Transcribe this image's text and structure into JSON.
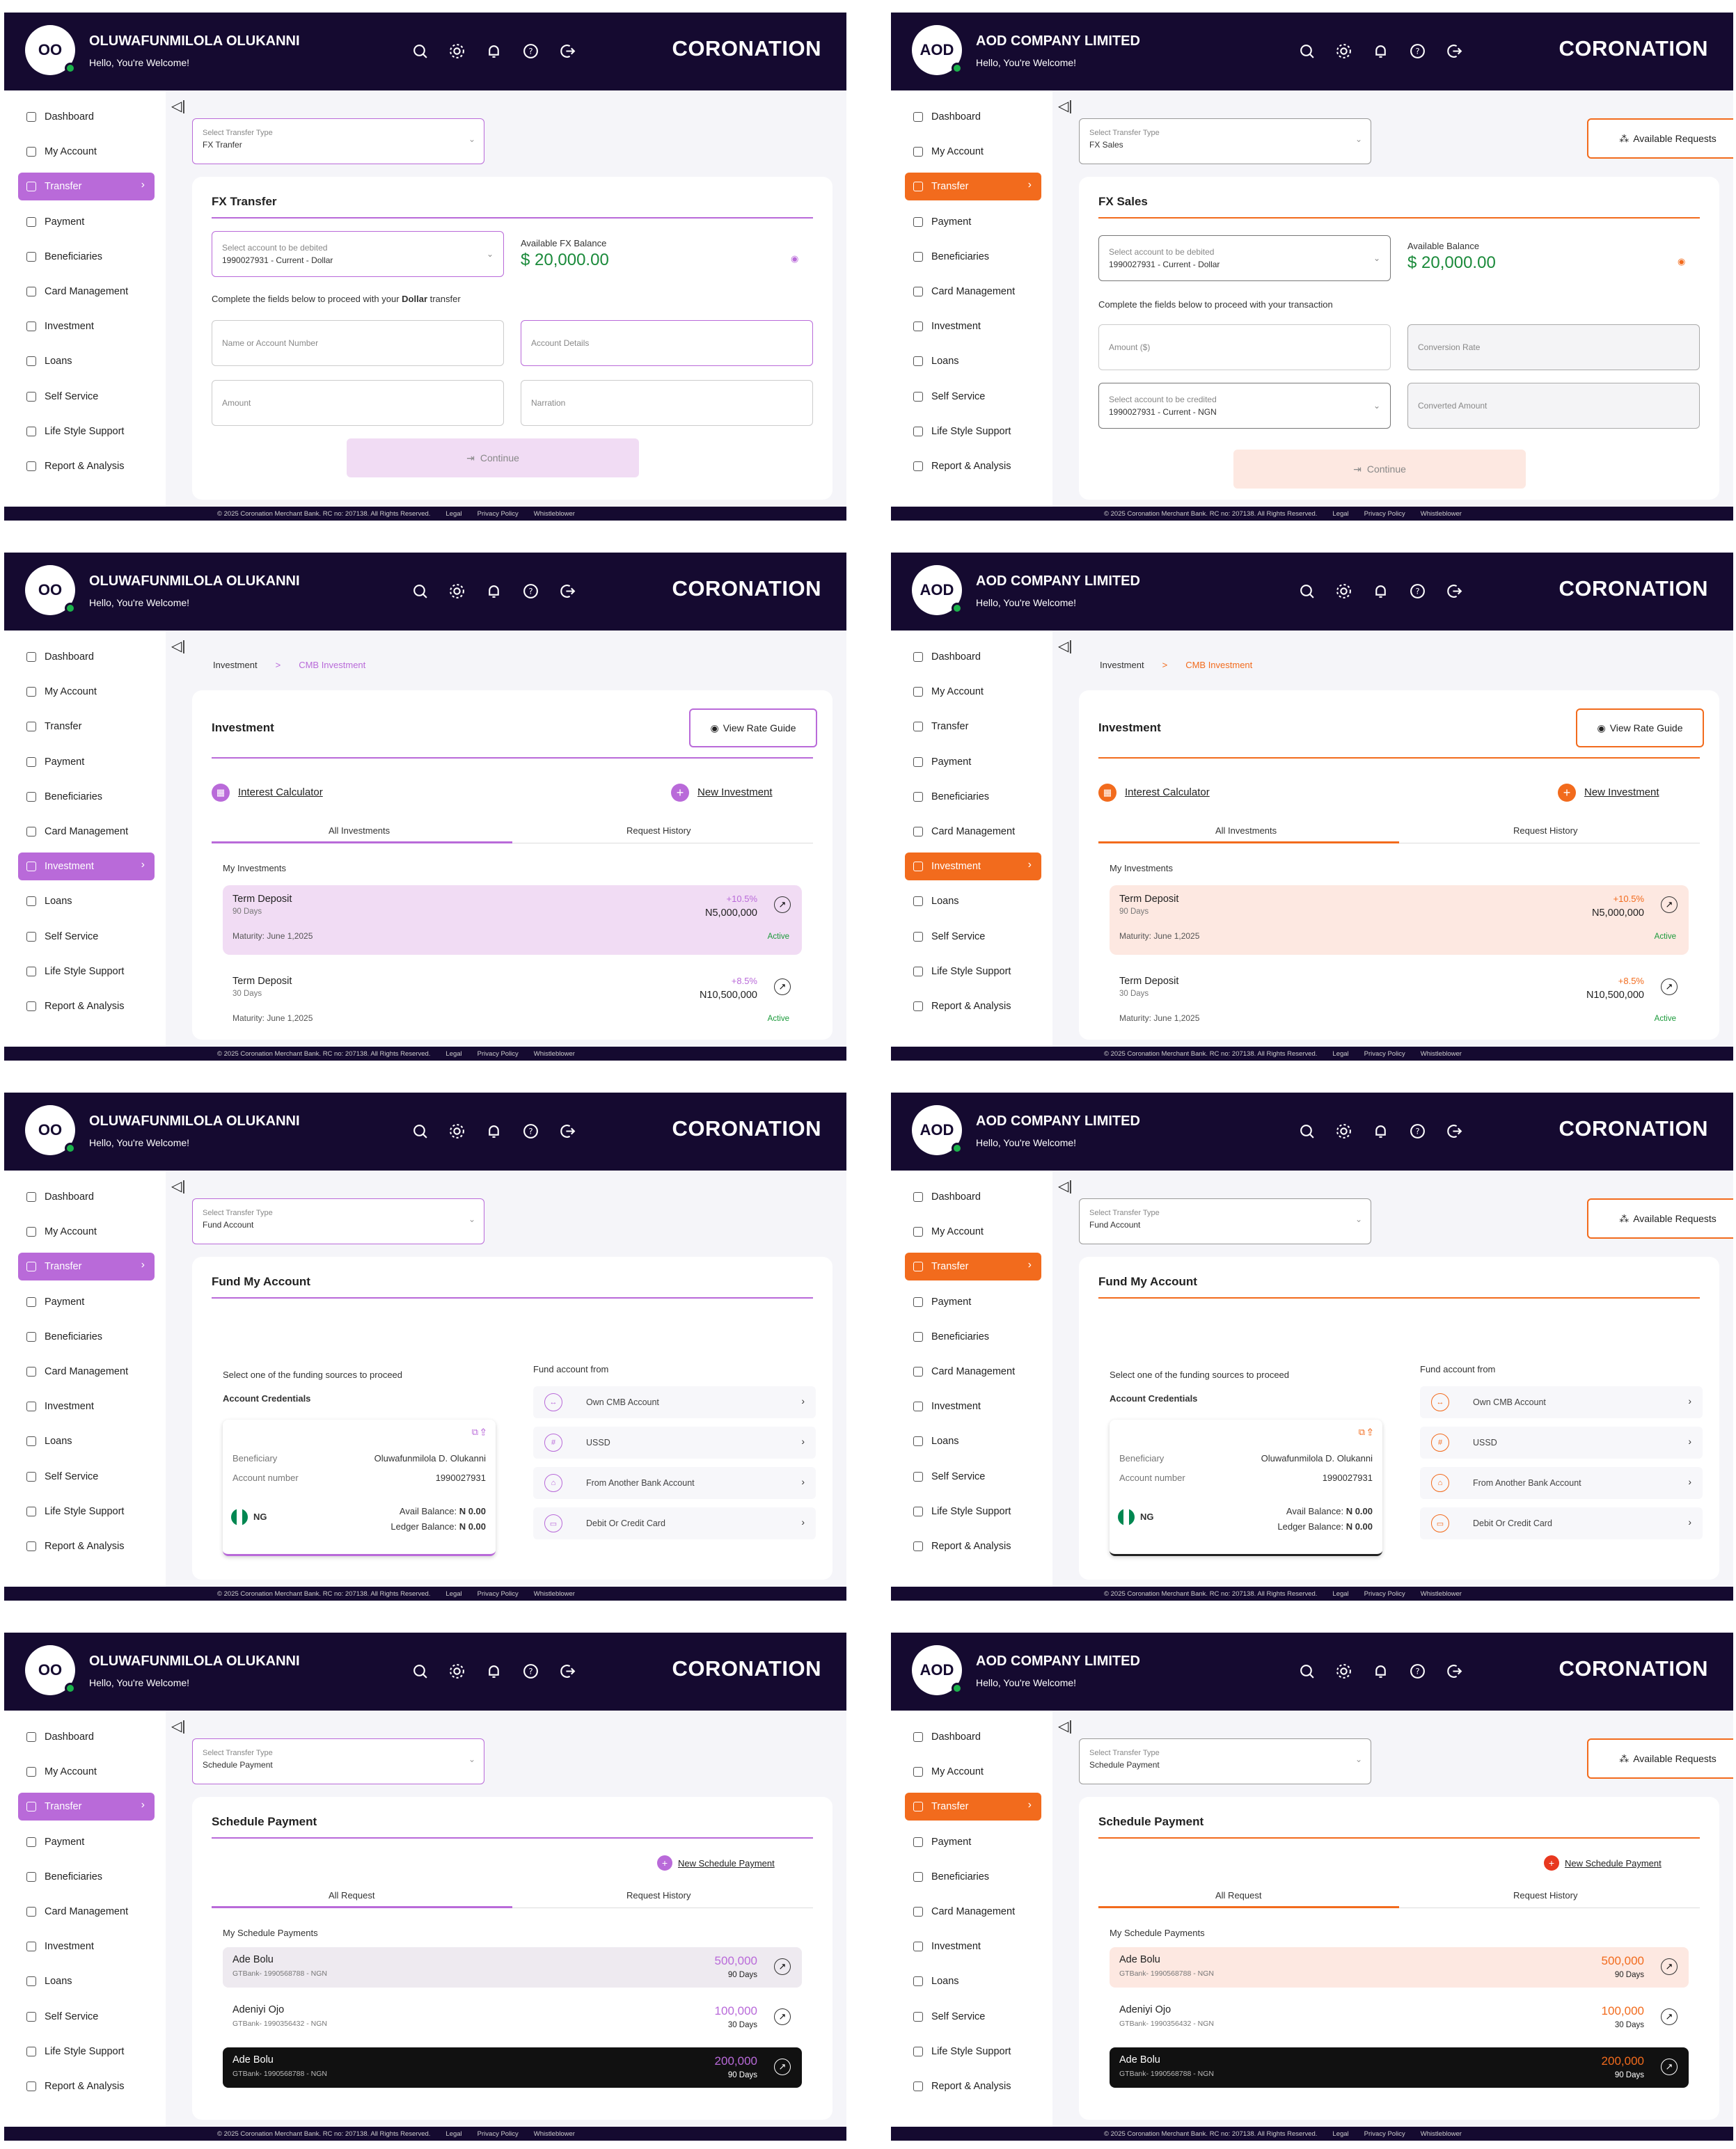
{
  "users": {
    "a": {
      "initials": "OO",
      "name": "OLUWAFUNMILOLA OLUKANNI",
      "greeting": "Hello, You're Welcome!"
    },
    "b": {
      "initials": "AOD",
      "name": "AOD COMPANY LIMITED",
      "greeting": "Hello, You're Welcome!"
    }
  },
  "brand": "CORONATION",
  "theme": {
    "a": {
      "accent": "#b96ad9",
      "light": "#f1dcf4",
      "rule": "#b96ad9"
    },
    "b": {
      "accent": "#f26b1d",
      "light": "#fde8e1",
      "rule": "#f26b1d"
    }
  },
  "header_icons": [
    "search-icon",
    "gear-icon",
    "bell-icon",
    "help-icon",
    "logout-icon"
  ],
  "nav": [
    "Dashboard",
    "My Account",
    "Transfer",
    "Payment",
    "Beneficiaries",
    "Card Management",
    "Investment",
    "Loans",
    "Self Service",
    "Life Style Support",
    "Report & Analysis"
  ],
  "footer": {
    "copyright": "© 2025 Coronation Merchant Bank. RC no: 207138. All Rights Reserved.",
    "legal": "Legal",
    "privacy": "Privacy Policy",
    "whistle": "Whistleblower"
  },
  "available_requests": "Available Requests",
  "transfer_type_label": "Select Transfer Type",
  "continue": "Continue",
  "fx_transfer": {
    "type_value": "FX Tranfer",
    "title": "FX Transfer",
    "debit_label": "Select account to be debited",
    "debit_value": "1990027931 - Current - Dollar",
    "balance_label": "Available FX Balance",
    "balance": "$ 20,000.00",
    "instruction_pre": "Complete the fields below to proceed with your ",
    "instruction_bold": "Dollar",
    "instruction_post": " transfer",
    "f_name": "Name or Account Number",
    "f_details": "Account Details",
    "f_amount": "Amount",
    "f_narration": "Narration"
  },
  "fx_sales": {
    "type_value": "FX Sales",
    "title": "FX Sales",
    "debit_label": "Select account to be debited",
    "debit_value": "1990027931 - Current - Dollar",
    "balance_label": "Available Balance",
    "balance": "$ 20,000.00",
    "instruction": "Complete the fields below to proceed with your transaction",
    "f_amount": "Amount ($)",
    "f_rate": "Conversion Rate",
    "credit_label": "Select account to be credited",
    "credit_value": "1990027931 - Current - NGN",
    "f_converted": "Converted Amount"
  },
  "investment": {
    "crumb1": "Investment",
    "crumb_sep": ">",
    "crumb2": "CMB Investment",
    "title": "Investment",
    "rate_guide": "View Rate Guide",
    "calc": "Interest Calculator",
    "new": "New Investment",
    "tab1": "All Investments",
    "tab2": "Request History",
    "section": "My Investments",
    "items": [
      {
        "name": "Term Deposit",
        "days": "90 Days",
        "rate": "+10.5%",
        "amount": "N5,000,000",
        "maturity": "Maturity: June 1,2025",
        "status": "Active"
      },
      {
        "name": "Term Deposit",
        "days": "30 Days",
        "rate": "+8.5%",
        "amount": "N10,500,000",
        "maturity": "Maturity: June 1,2025",
        "status": "Active"
      }
    ]
  },
  "fund": {
    "type_value": "Fund Account",
    "title": "Fund My Account",
    "select_text": "Select one of the funding sources to proceed",
    "cred_title": "Account Credentials",
    "ben_label": "Beneficiary",
    "ben_value": "Oluwafunmilola D. Olukanni",
    "acc_label": "Account number",
    "acc_value": "1990027931",
    "country": "NG",
    "avail": "Avail Balance: ",
    "avail_val": "N 0.00",
    "ledger": "Ledger Balance: ",
    "ledger_val": "N 0.00",
    "from_title": "Fund account from",
    "sources": [
      "Own CMB Account",
      "USSD",
      "From Another Bank Account",
      "Debit Or Credit Card"
    ]
  },
  "schedule": {
    "type_value": "Schedule Payment",
    "title": "Schedule Payment",
    "new": "New Schedule Payment",
    "tab1": "All Request",
    "tab2": "Request History",
    "section": "My Schedule Payments",
    "items": [
      {
        "name": "Ade Bolu",
        "bank": "GTBank- 1990568788 - NGN",
        "amount": "500,000",
        "days": "90 Days"
      },
      {
        "name": "Adeniyi Ojo",
        "bank": "GTBank- 1990356432 - NGN",
        "amount": "100,000",
        "days": "30 Days"
      },
      {
        "name": "Ade Bolu",
        "bank": "GTBank- 1990568788 - NGN",
        "amount": "200,000",
        "days": "90 Days"
      }
    ]
  }
}
